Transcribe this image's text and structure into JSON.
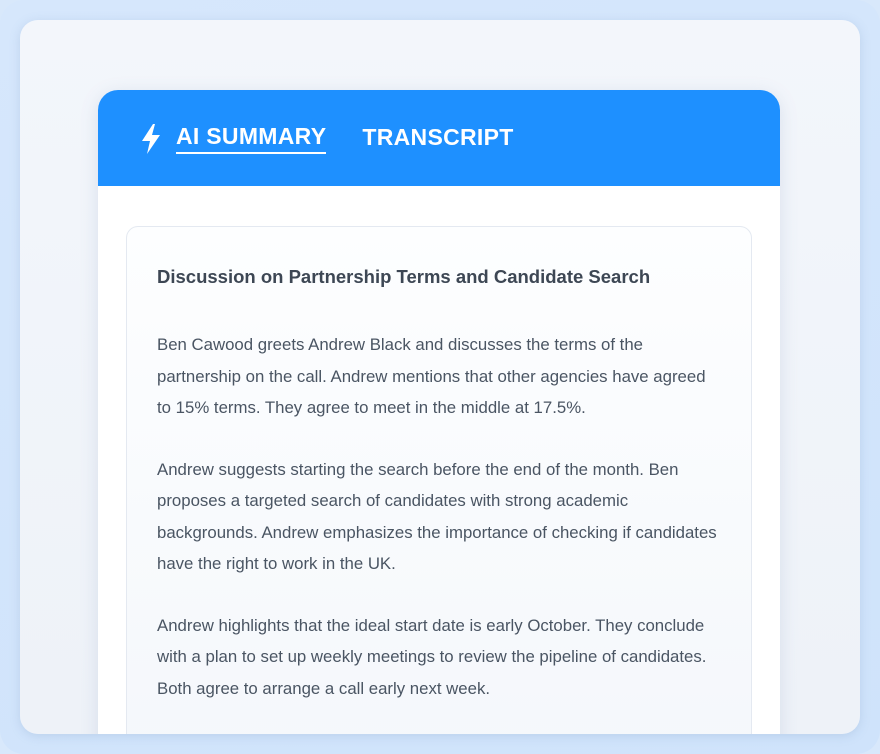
{
  "header": {
    "icon": "lightning-bolt-icon",
    "tabs": [
      {
        "label": "AI SUMMARY",
        "active": true
      },
      {
        "label": "TRANSCRIPT",
        "active": false
      }
    ],
    "accent_color": "#1e90ff"
  },
  "summary": {
    "title": "Discussion on Partnership Terms and Candidate Search",
    "paragraphs": [
      "Ben Cawood greets Andrew Black and discusses the terms of the partnership on the call. Andrew mentions that other agencies have agreed to 15% terms. They agree to meet in the middle at 17.5%.",
      "Andrew suggests starting the search before the end of the month. Ben proposes a targeted search of candidates with strong academic backgrounds. Andrew emphasizes the importance of checking if candidates have the right to work in the UK.",
      "Andrew highlights that the ideal start date is early October. They conclude with a plan to set up weekly meetings to review the pipeline of candidates. Both agree to arrange a call early next week."
    ]
  }
}
